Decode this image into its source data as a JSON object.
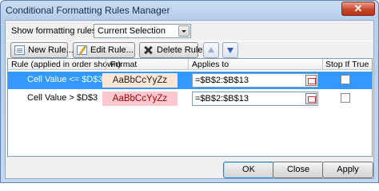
{
  "window": {
    "title": "Conditional Formatting Rules Manager",
    "close_symbol": "✕"
  },
  "show_rules": {
    "label_prefix": "Show formatting rules for:",
    "selected": "Current Selection"
  },
  "toolbar": {
    "new_rule": "New Rule...",
    "edit_rule": "Edit Rule...",
    "delete_rule": "Delete Rule"
  },
  "table": {
    "headers": [
      "Rule (applied in order shown)",
      "Format",
      "Applies to",
      "Stop If True"
    ],
    "rows": [
      {
        "rule": "Cell Value <= $D$3",
        "format_sample": "AaBbCcYyZz",
        "applies_to": "=$B$2:$B$13",
        "stop_if_true": false,
        "selected": true,
        "format_bg": "#fbe5d6",
        "format_color": "#1f1f1f"
      },
      {
        "rule": "Cell Value > $D$3",
        "format_sample": "AaBbCcYyZz",
        "applies_to": "=$B$2:$B$13",
        "stop_if_true": false,
        "selected": false,
        "format_bg": "#ffc7ce",
        "format_color": "#9c0006"
      }
    ]
  },
  "buttons": {
    "ok": "OK",
    "close": "Close",
    "apply": "Apply"
  },
  "colors": {
    "selection": "#3399ff",
    "title_bg": "#c4d8ef",
    "close_button": "#c9472d"
  }
}
